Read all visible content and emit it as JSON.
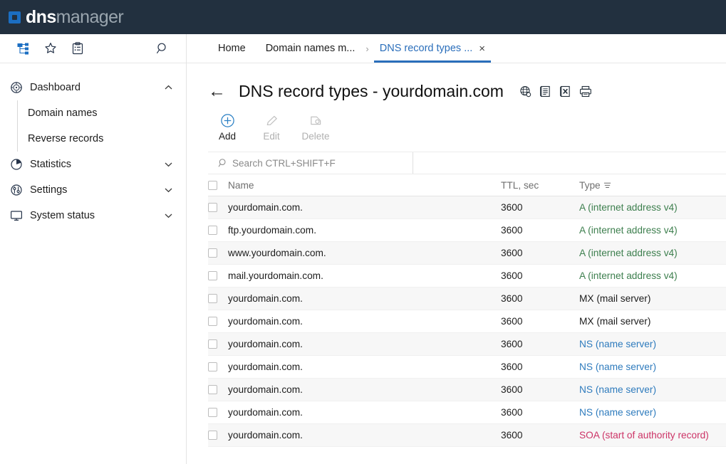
{
  "app": {
    "logo_primary": "dns",
    "logo_secondary": "manager",
    "logo_icon": "square-dot-icon"
  },
  "sidebar": {
    "toolbar": [
      {
        "name": "hierarchy-icon",
        "label": "Hierarchy",
        "active": true
      },
      {
        "name": "star-icon",
        "label": "Favorites",
        "active": false
      },
      {
        "name": "clipboard-icon",
        "label": "Tasks",
        "active": false
      },
      {
        "name": "search-icon",
        "label": "Search",
        "active": false
      }
    ],
    "items": [
      {
        "label": "Dashboard",
        "icon": "dashboard-icon",
        "chevron": "up",
        "expanded": true
      },
      {
        "label": "Statistics",
        "icon": "pie-chart-icon",
        "chevron": "down",
        "expanded": false
      },
      {
        "label": "Settings",
        "icon": "sliders-icon",
        "chevron": "down",
        "expanded": false
      },
      {
        "label": "System status",
        "icon": "monitor-icon",
        "chevron": "down",
        "expanded": false
      }
    ],
    "sub_items": [
      {
        "label": "Domain names"
      },
      {
        "label": "Reverse records"
      }
    ]
  },
  "tabs": {
    "items": [
      {
        "label": "Home",
        "active": false,
        "closable": false
      },
      {
        "label": "Domain names m...",
        "active": false,
        "closable": false
      },
      {
        "label": "DNS record types ...",
        "active": true,
        "closable": true
      }
    ],
    "separator": "›",
    "close_glyph": "×"
  },
  "page": {
    "back_glyph": "←",
    "title": "DNS record types - yourdomain.com",
    "title_icons": [
      {
        "name": "globe-web-icon",
        "label": "Web"
      },
      {
        "name": "report-document-icon",
        "label": "Report"
      },
      {
        "name": "excel-export-icon",
        "label": "Export to Excel"
      },
      {
        "name": "print-icon",
        "label": "Print"
      }
    ]
  },
  "toolbar": {
    "add_label": "Add",
    "edit_label": "Edit",
    "delete_label": "Delete",
    "add_enabled": true,
    "edit_enabled": false,
    "delete_enabled": false
  },
  "search": {
    "placeholder": "Search CTRL+SHIFT+F",
    "value": ""
  },
  "table": {
    "columns": {
      "name": "Name",
      "ttl": "TTL, sec",
      "type": "Type"
    },
    "sort_icon": "sort-lines-icon",
    "type_colors": {
      "A": "#3d7f4e",
      "MX": "#1d1d1d",
      "NS": "#2e7bbd",
      "SOA": "#cc3366"
    },
    "rows": [
      {
        "name": "yourdomain.com.",
        "ttl": "3600",
        "type": "A (internet address v4)",
        "type_key": "A",
        "checked": false
      },
      {
        "name": "ftp.yourdomain.com.",
        "ttl": "3600",
        "type": "A (internet address v4)",
        "type_key": "A",
        "checked": false
      },
      {
        "name": "www.yourdomain.com.",
        "ttl": "3600",
        "type": "A (internet address v4)",
        "type_key": "A",
        "checked": false
      },
      {
        "name": "mail.yourdomain.com.",
        "ttl": "3600",
        "type": "A (internet address v4)",
        "type_key": "A",
        "checked": false
      },
      {
        "name": "yourdomain.com.",
        "ttl": "3600",
        "type": "MX (mail server)",
        "type_key": "MX",
        "checked": false
      },
      {
        "name": "yourdomain.com.",
        "ttl": "3600",
        "type": "MX (mail server)",
        "type_key": "MX",
        "checked": false
      },
      {
        "name": "yourdomain.com.",
        "ttl": "3600",
        "type": "NS (name server)",
        "type_key": "NS",
        "checked": false
      },
      {
        "name": "yourdomain.com.",
        "ttl": "3600",
        "type": "NS (name server)",
        "type_key": "NS",
        "checked": false
      },
      {
        "name": "yourdomain.com.",
        "ttl": "3600",
        "type": "NS (name server)",
        "type_key": "NS",
        "checked": false
      },
      {
        "name": "yourdomain.com.",
        "ttl": "3600",
        "type": "NS (name server)",
        "type_key": "NS",
        "checked": false
      },
      {
        "name": "yourdomain.com.",
        "ttl": "3600",
        "type": "SOA (start of authority record)",
        "type_key": "SOA",
        "checked": false
      }
    ]
  },
  "colors": {
    "header_bg": "#22303f",
    "accent_blue": "#2a6ebb",
    "logo_blue": "#1b6ec2"
  }
}
